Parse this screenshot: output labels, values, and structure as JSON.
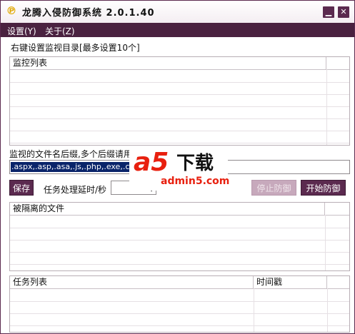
{
  "window": {
    "title": "龙腾入侵防御系统 2.0.1.40",
    "app_icon": "app-logo-icon",
    "minimize_glyph": "▁",
    "close_glyph": "✕"
  },
  "menu": {
    "items": [
      {
        "label": "设置(Y)"
      },
      {
        "label": "关于(Z)"
      }
    ]
  },
  "monitor": {
    "hint": "右键设置监视目录[最多设置10个]",
    "list_header": "监控列表"
  },
  "suffix": {
    "label": "监视的文件名后缀,多个后缀请用",
    "value": ".aspx,.asp,.asa,.js,.php,.exe,.co"
  },
  "controls": {
    "save_label": "保存",
    "delay_label": "任务处理延时/秒",
    "delay_value": "",
    "stop_label": "停止防御",
    "start_label": "开始防御"
  },
  "quarantine": {
    "list_header": "被隔离的文件"
  },
  "tasks": {
    "columns": [
      "任务列表",
      "时间戳"
    ]
  },
  "watermark": {
    "brand": "a5",
    "download": "下载",
    "url": "admin5.com"
  },
  "colors": {
    "accent": "#5b2a4f",
    "menubar": "#4a2240",
    "selection": "#0a246a",
    "watermark_red": "#e8200f"
  }
}
